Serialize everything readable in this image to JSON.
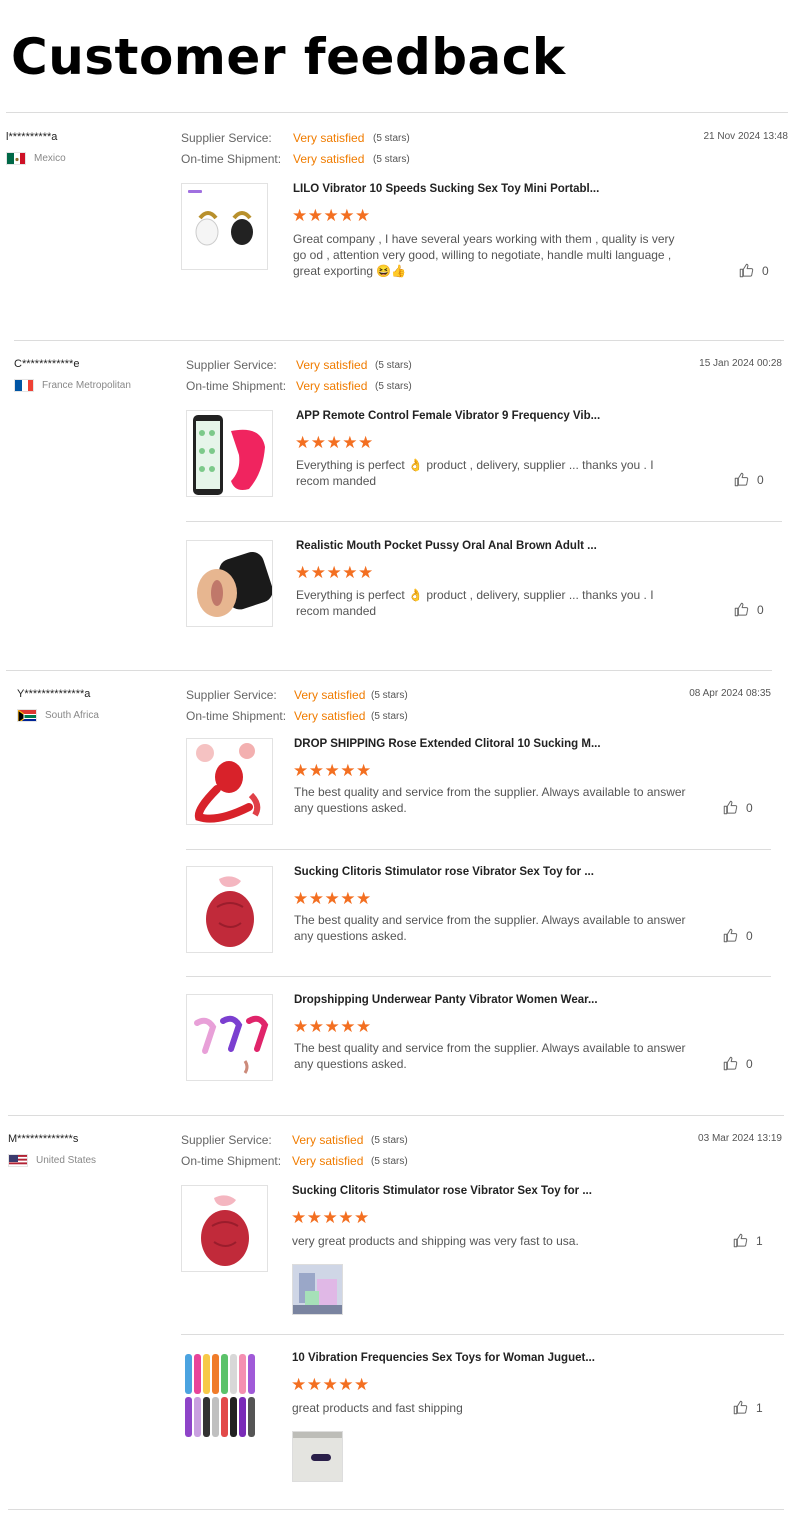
{
  "page": {
    "title": "Customer feedback"
  },
  "labels": {
    "supplier_service": "Supplier Service:",
    "ontime_shipment": "On-time Shipment:"
  },
  "reviews": [
    {
      "reviewer": "l**********a",
      "country": "Mexico",
      "date": "21 Nov 2024 13:48",
      "supplier_rating": "Very satisfied",
      "supplier_stars": "(5 stars)",
      "shipment_rating": "Very satisfied",
      "shipment_stars": "(5 stars)",
      "items": [
        {
          "product": "LILO Vibrator 10 Speeds Sucking Sex Toy Mini Portabl...",
          "rating": "★★★★★",
          "comment": "Great company , I have several years working with them , quality is very go od , attention very good, willing to negotiate, handle multi language , great exporting 😆👍",
          "likes": "0"
        }
      ]
    },
    {
      "reviewer": "C************e",
      "country": "France Metropolitan",
      "date": "15 Jan 2024 00:28",
      "supplier_rating": "Very satisfied",
      "supplier_stars": "(5 stars)",
      "shipment_rating": "Very satisfied",
      "shipment_stars": "(5 stars)",
      "items": [
        {
          "product": "APP Remote Control Female Vibrator 9 Frequency Vib...",
          "rating": "★★★★★",
          "comment": "Everything is perfect 👌 product , delivery, supplier ... thanks you . I recom manded",
          "likes": "0"
        },
        {
          "product": "Realistic Mouth Pocket Pussy Oral Anal Brown Adult ...",
          "rating": "★★★★★",
          "comment": "Everything is perfect 👌 product , delivery, supplier ... thanks you . I recom manded",
          "likes": "0"
        }
      ]
    },
    {
      "reviewer": "Y**************a",
      "country": "South Africa",
      "date": "08 Apr 2024 08:35",
      "supplier_rating": "Very satisfied",
      "supplier_stars": "(5 stars)",
      "shipment_rating": "Very satisfied",
      "shipment_stars": "(5 stars)",
      "items": [
        {
          "product": "DROP SHIPPING Rose Extended Clitoral 10 Sucking M...",
          "rating": "★★★★★",
          "comment": "The best quality and service from the supplier. Always available to answer any questions asked.",
          "likes": "0"
        },
        {
          "product": "Sucking Clitoris Stimulator rose Vibrator Sex Toy for ...",
          "rating": "★★★★★",
          "comment": "The best quality and service from the supplier. Always available to answer any questions asked.",
          "likes": "0"
        },
        {
          "product": "Dropshipping Underwear Panty Vibrator Women Wear...",
          "rating": "★★★★★",
          "comment": "The best quality and service from the supplier. Always available to answer any questions asked.",
          "likes": "0"
        }
      ]
    },
    {
      "reviewer": "M*************s",
      "country": "United States",
      "date": "03 Mar 2024 13:19",
      "supplier_rating": "Very satisfied",
      "supplier_stars": "(5 stars)",
      "shipment_rating": "Very satisfied",
      "shipment_stars": "(5 stars)",
      "items": [
        {
          "product": "Sucking Clitoris Stimulator rose Vibrator Sex Toy for ...",
          "rating": "★★★★★",
          "comment": "very great products and shipping was very fast to usa.",
          "likes": "1"
        },
        {
          "product": "10 Vibration Frequencies Sex Toys for Woman Juguet...",
          "rating": "★★★★★",
          "comment": "great products and fast shipping",
          "likes": "1"
        }
      ]
    }
  ],
  "icons": {
    "like": "thumbs-up-icon",
    "flags": [
      "mexico-flag-icon",
      "france-flag-icon",
      "south-africa-flag-icon",
      "united-states-flag-icon"
    ]
  },
  "colors": {
    "accent": "#f07c00",
    "stars": "#f36f21"
  }
}
